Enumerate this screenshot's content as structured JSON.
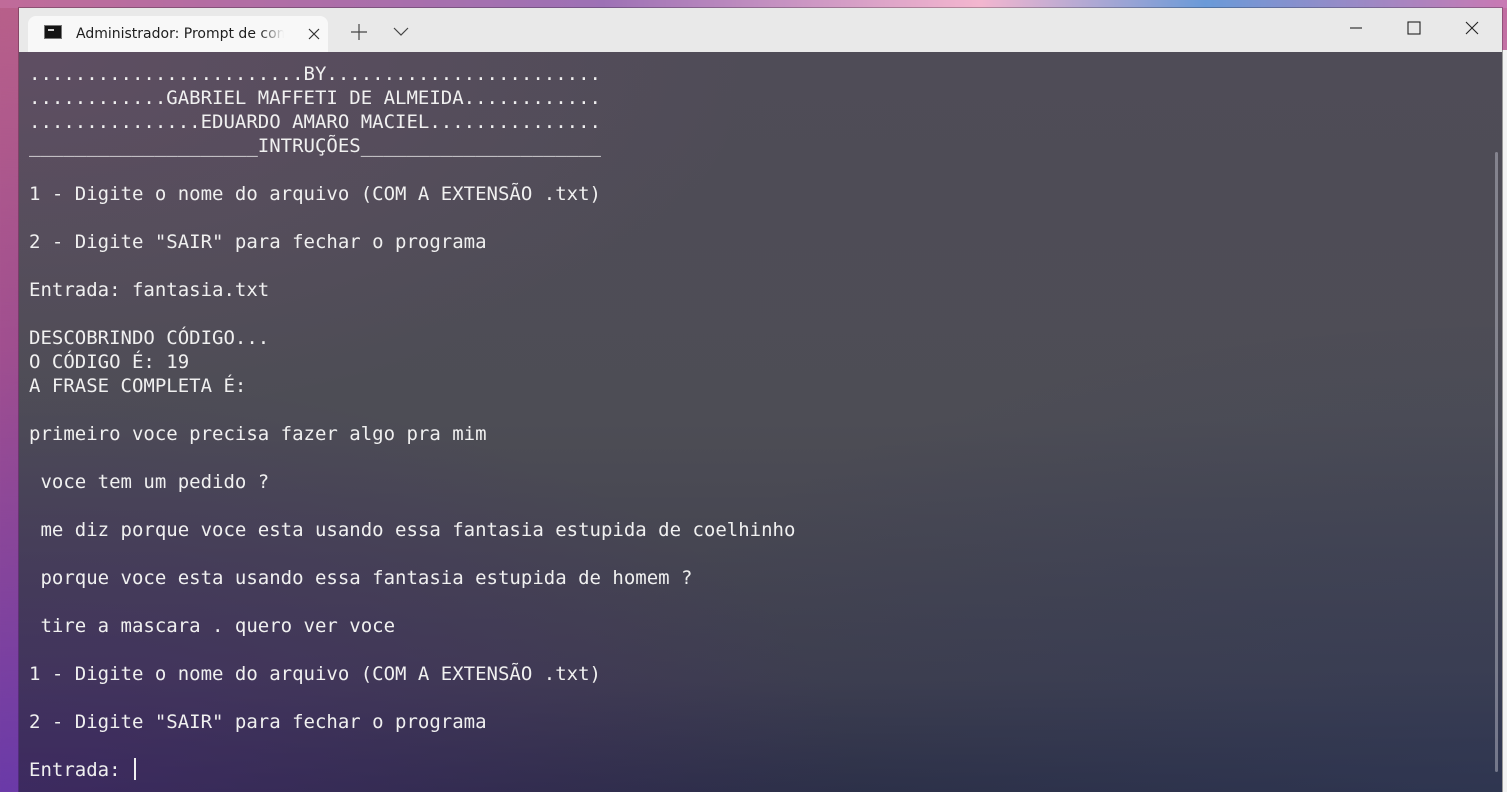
{
  "window": {
    "tab_title": "Administrador: Prompt de comando",
    "new_tab_label": "+",
    "minimize_label": "Minimize",
    "maximize_label": "Maximize",
    "close_label": "Close"
  },
  "terminal": {
    "lines": [
      "........................BY........................",
      "............GABRIEL MAFFETI DE ALMEIDA............",
      "...............EDUARDO AMARO MACIEL...............",
      "____________________INTRUÇÕES_____________________",
      "",
      "1 - Digite o nome do arquivo (COM A EXTENSÃO .txt)",
      "",
      "2 - Digite \"SAIR\" para fechar o programa",
      "",
      "Entrada: fantasia.txt",
      "",
      "DESCOBRINDO CÓDIGO...",
      "O CÓDIGO É: 19",
      "A FRASE COMPLETA É:",
      "",
      "primeiro voce precisa fazer algo pra mim",
      "",
      " voce tem um pedido ?",
      "",
      " me diz porque voce esta usando essa fantasia estupida de coelhinho",
      "",
      " porque voce esta usando essa fantasia estupida de homem ?",
      "",
      " tire a mascara . quero ver voce",
      "",
      "1 - Digite o nome do arquivo (COM A EXTENSÃO .txt)",
      "",
      "2 - Digite \"SAIR\" para fechar o programa",
      ""
    ],
    "prompt": "Entrada: ",
    "input_value": ""
  }
}
